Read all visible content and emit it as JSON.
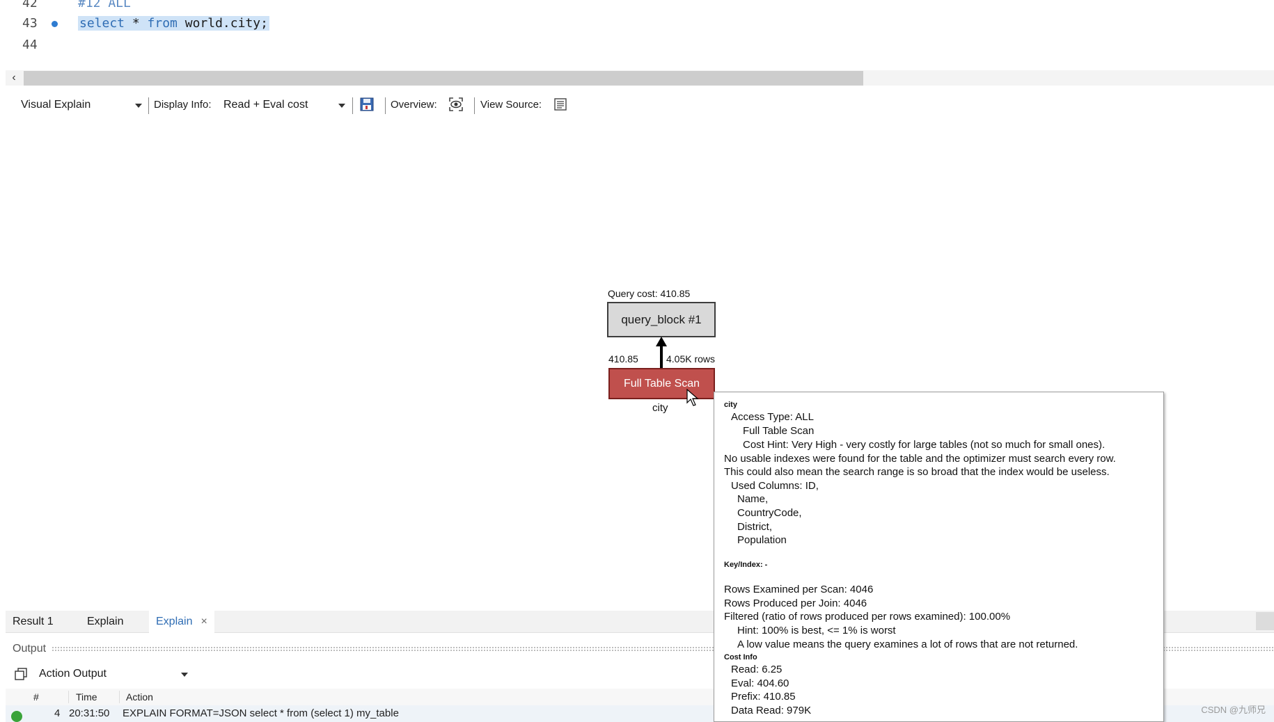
{
  "editor": {
    "lines": [
      {
        "number": "42",
        "text": "#12 ALL"
      },
      {
        "number": "43",
        "text_parts": {
          "kw1": "select",
          "mid": " * ",
          "kw2": "from",
          "tail": " world.city;"
        }
      },
      {
        "number": "44",
        "text": ""
      }
    ]
  },
  "toolbar": {
    "view_mode": "Visual Explain",
    "display_info_label": "Display Info:",
    "display_info_value": "Read + Eval cost",
    "overview_label": "Overview:",
    "view_source_label": "View Source:",
    "icons": [
      "save-icon",
      "overview-icon",
      "view-source-icon"
    ]
  },
  "diagram": {
    "query_cost": "Query cost: 410.85",
    "query_block": "query_block #1",
    "edge_cost": "410.85",
    "edge_rows": "4.05K rows",
    "scan_label": "Full Table Scan",
    "table_name": "city",
    "scan_color": "#c0504d"
  },
  "tooltip": {
    "title": "city",
    "access_type": "Access Type: ALL",
    "scan": "Full Table Scan",
    "cost_hint": "Cost Hint: Very High - very costly for large tables (not so much for small ones).",
    "no_index_1": "No usable indexes were found for the table and the optimizer must search every row.",
    "no_index_2": "This could also mean the search range is so broad that the index would be useless.",
    "used_columns": "Used Columns:  ID,",
    "col_name": "Name,",
    "col_countrycode": "CountryCode,",
    "col_district": "District,",
    "col_population": "Population",
    "key_index": "Key/Index: -",
    "rows_examined": "Rows Examined per Scan:  4046",
    "rows_produced": "Rows Produced per Join:  4046",
    "filtered": "Filtered (ratio of rows produced per rows examined):  100.00%",
    "hint": "Hint: 100% is best, <= 1% is worst",
    "low_value": "A low value means the query examines a lot of rows that are not returned.",
    "cost_info_title": "Cost Info",
    "read": "Read: 6.25",
    "eval": "Eval: 404.60",
    "prefix": "Prefix: 410.85",
    "data_read": "Data Read: 979K"
  },
  "tabs": [
    {
      "label": "Result 1"
    },
    {
      "label": "Explain"
    },
    {
      "label": "Explain",
      "close": "×"
    }
  ],
  "output": {
    "label": "Output",
    "selector": "Action Output",
    "columns": [
      "#",
      "Time",
      "Action"
    ],
    "row": {
      "num": "4",
      "time": "20:31:50",
      "action": "EXPLAIN FORMAT=JSON select * from (select 1) my_table",
      "status_color": "#3aa33a"
    }
  },
  "watermark": "CSDN @九师兄"
}
